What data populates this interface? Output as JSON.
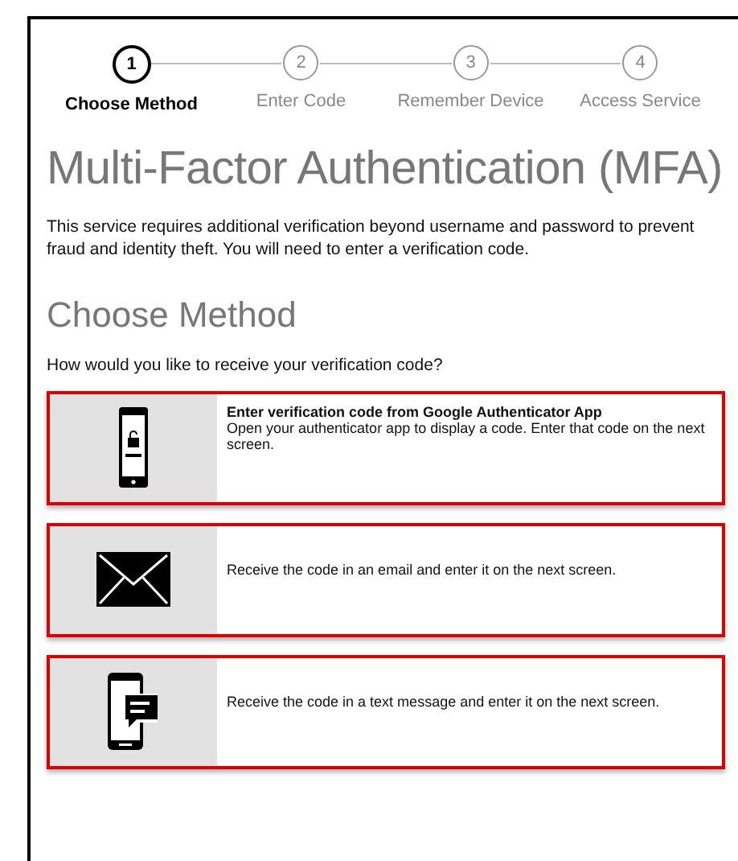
{
  "steps": [
    {
      "number": "1",
      "label": "Choose Method",
      "selected": true
    },
    {
      "number": "2",
      "label": "Enter Code",
      "selected": false
    },
    {
      "number": "3",
      "label": "Remember Device",
      "selected": false
    },
    {
      "number": "4",
      "label": "Access Service",
      "selected": false
    }
  ],
  "title": "Multi-Factor Authentication (MFA)",
  "intro": "This service requires additional verification beyond username and password to prevent fraud and identity theft. You will need to enter a verification code.",
  "section_heading": "Choose Method",
  "question": "How would you like to receive your verification code?",
  "options": [
    {
      "kind": "authenticator",
      "title": "Enter verification code from Google Authenticator App",
      "text": "Open your authenticator app to display a code. Enter that code on the next screen."
    },
    {
      "kind": "email",
      "text": "Receive the code in an email and enter it on the next screen."
    },
    {
      "kind": "sms",
      "text": "Receive the code in a text message and enter it on the next screen."
    }
  ]
}
